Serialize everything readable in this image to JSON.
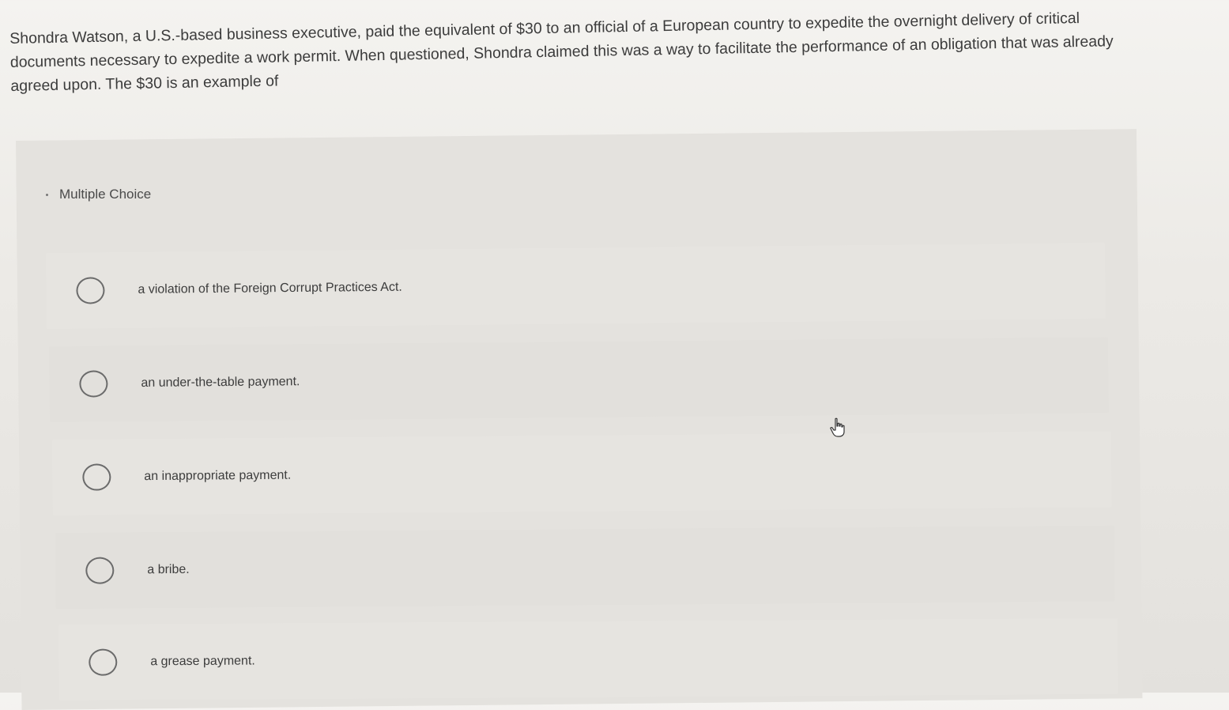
{
  "question": {
    "text": "Shondra Watson, a U.S.-based business executive, paid the equivalent of $30 to an official of a European country to expedite the overnight delivery of critical documents necessary to expedite a work permit. When questioned, Shondra claimed this was a way to facilitate the performance of an obligation that was already agreed upon. The $30 is an example of"
  },
  "multiple_choice": {
    "header": "Multiple Choice",
    "options": [
      {
        "label": "a violation of the Foreign Corrupt Practices Act."
      },
      {
        "label": "an under-the-table payment."
      },
      {
        "label": "an inappropriate payment."
      },
      {
        "label": "a bribe."
      },
      {
        "label": "a grease payment."
      }
    ]
  },
  "icons": {
    "cursor": "hand-pointer-icon",
    "radio": "radio-unselected-icon"
  }
}
